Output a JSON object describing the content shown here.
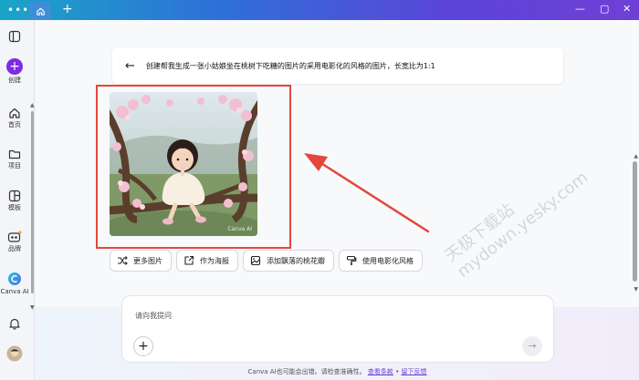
{
  "titlebar": {
    "menu_glyph": "•••",
    "home_tab_icon": "home-icon",
    "new_tab_glyph": "+",
    "minimize_glyph": "—",
    "maximize_glyph": "▢",
    "close_glyph": "✕"
  },
  "sidebar": {
    "toggle_icon": "sidebar-toggle-icon",
    "create": {
      "glyph": "+",
      "label": "创建"
    },
    "items": [
      {
        "label": "首页",
        "icon": "home-icon"
      },
      {
        "label": "项目",
        "icon": "folder-icon"
      },
      {
        "label": "模板",
        "icon": "template-icon"
      },
      {
        "label": "品牌",
        "icon": "brand-icon"
      },
      {
        "label": "Canva AI",
        "icon": "canva-ai-icon"
      }
    ],
    "notification_icon": "bell-icon",
    "avatar_icon": "avatar-icon"
  },
  "prompt": {
    "back_glyph": "←",
    "text": "创建帮我生成一张小姑娘坐在桃树下吃糖的图片的采用电影化的风格的图片，长宽比为1:1"
  },
  "image": {
    "watermark": "Canva AI"
  },
  "watermark": {
    "text": "mydown.yesky.com",
    "text2": "天极下载站"
  },
  "chips": [
    {
      "label": "更多图片",
      "icon": "shuffle-icon"
    },
    {
      "label": "作为海报",
      "icon": "export-icon"
    },
    {
      "label": "添加飘落的桃花瓣",
      "icon": "image-edit-icon"
    },
    {
      "label": "使用电影化风格",
      "icon": "paint-roller-icon"
    }
  ],
  "input": {
    "placeholder": "请向我提问",
    "plus_glyph": "+",
    "send_glyph": "→"
  },
  "footer": {
    "text": "Canva AI也可能会出错。请检查准确性。",
    "link1": "查看条款",
    "separator": " • ",
    "link2": "留下反馈"
  },
  "colors": {
    "accent": "#7d2ae8",
    "annotation": "#e4473c"
  }
}
